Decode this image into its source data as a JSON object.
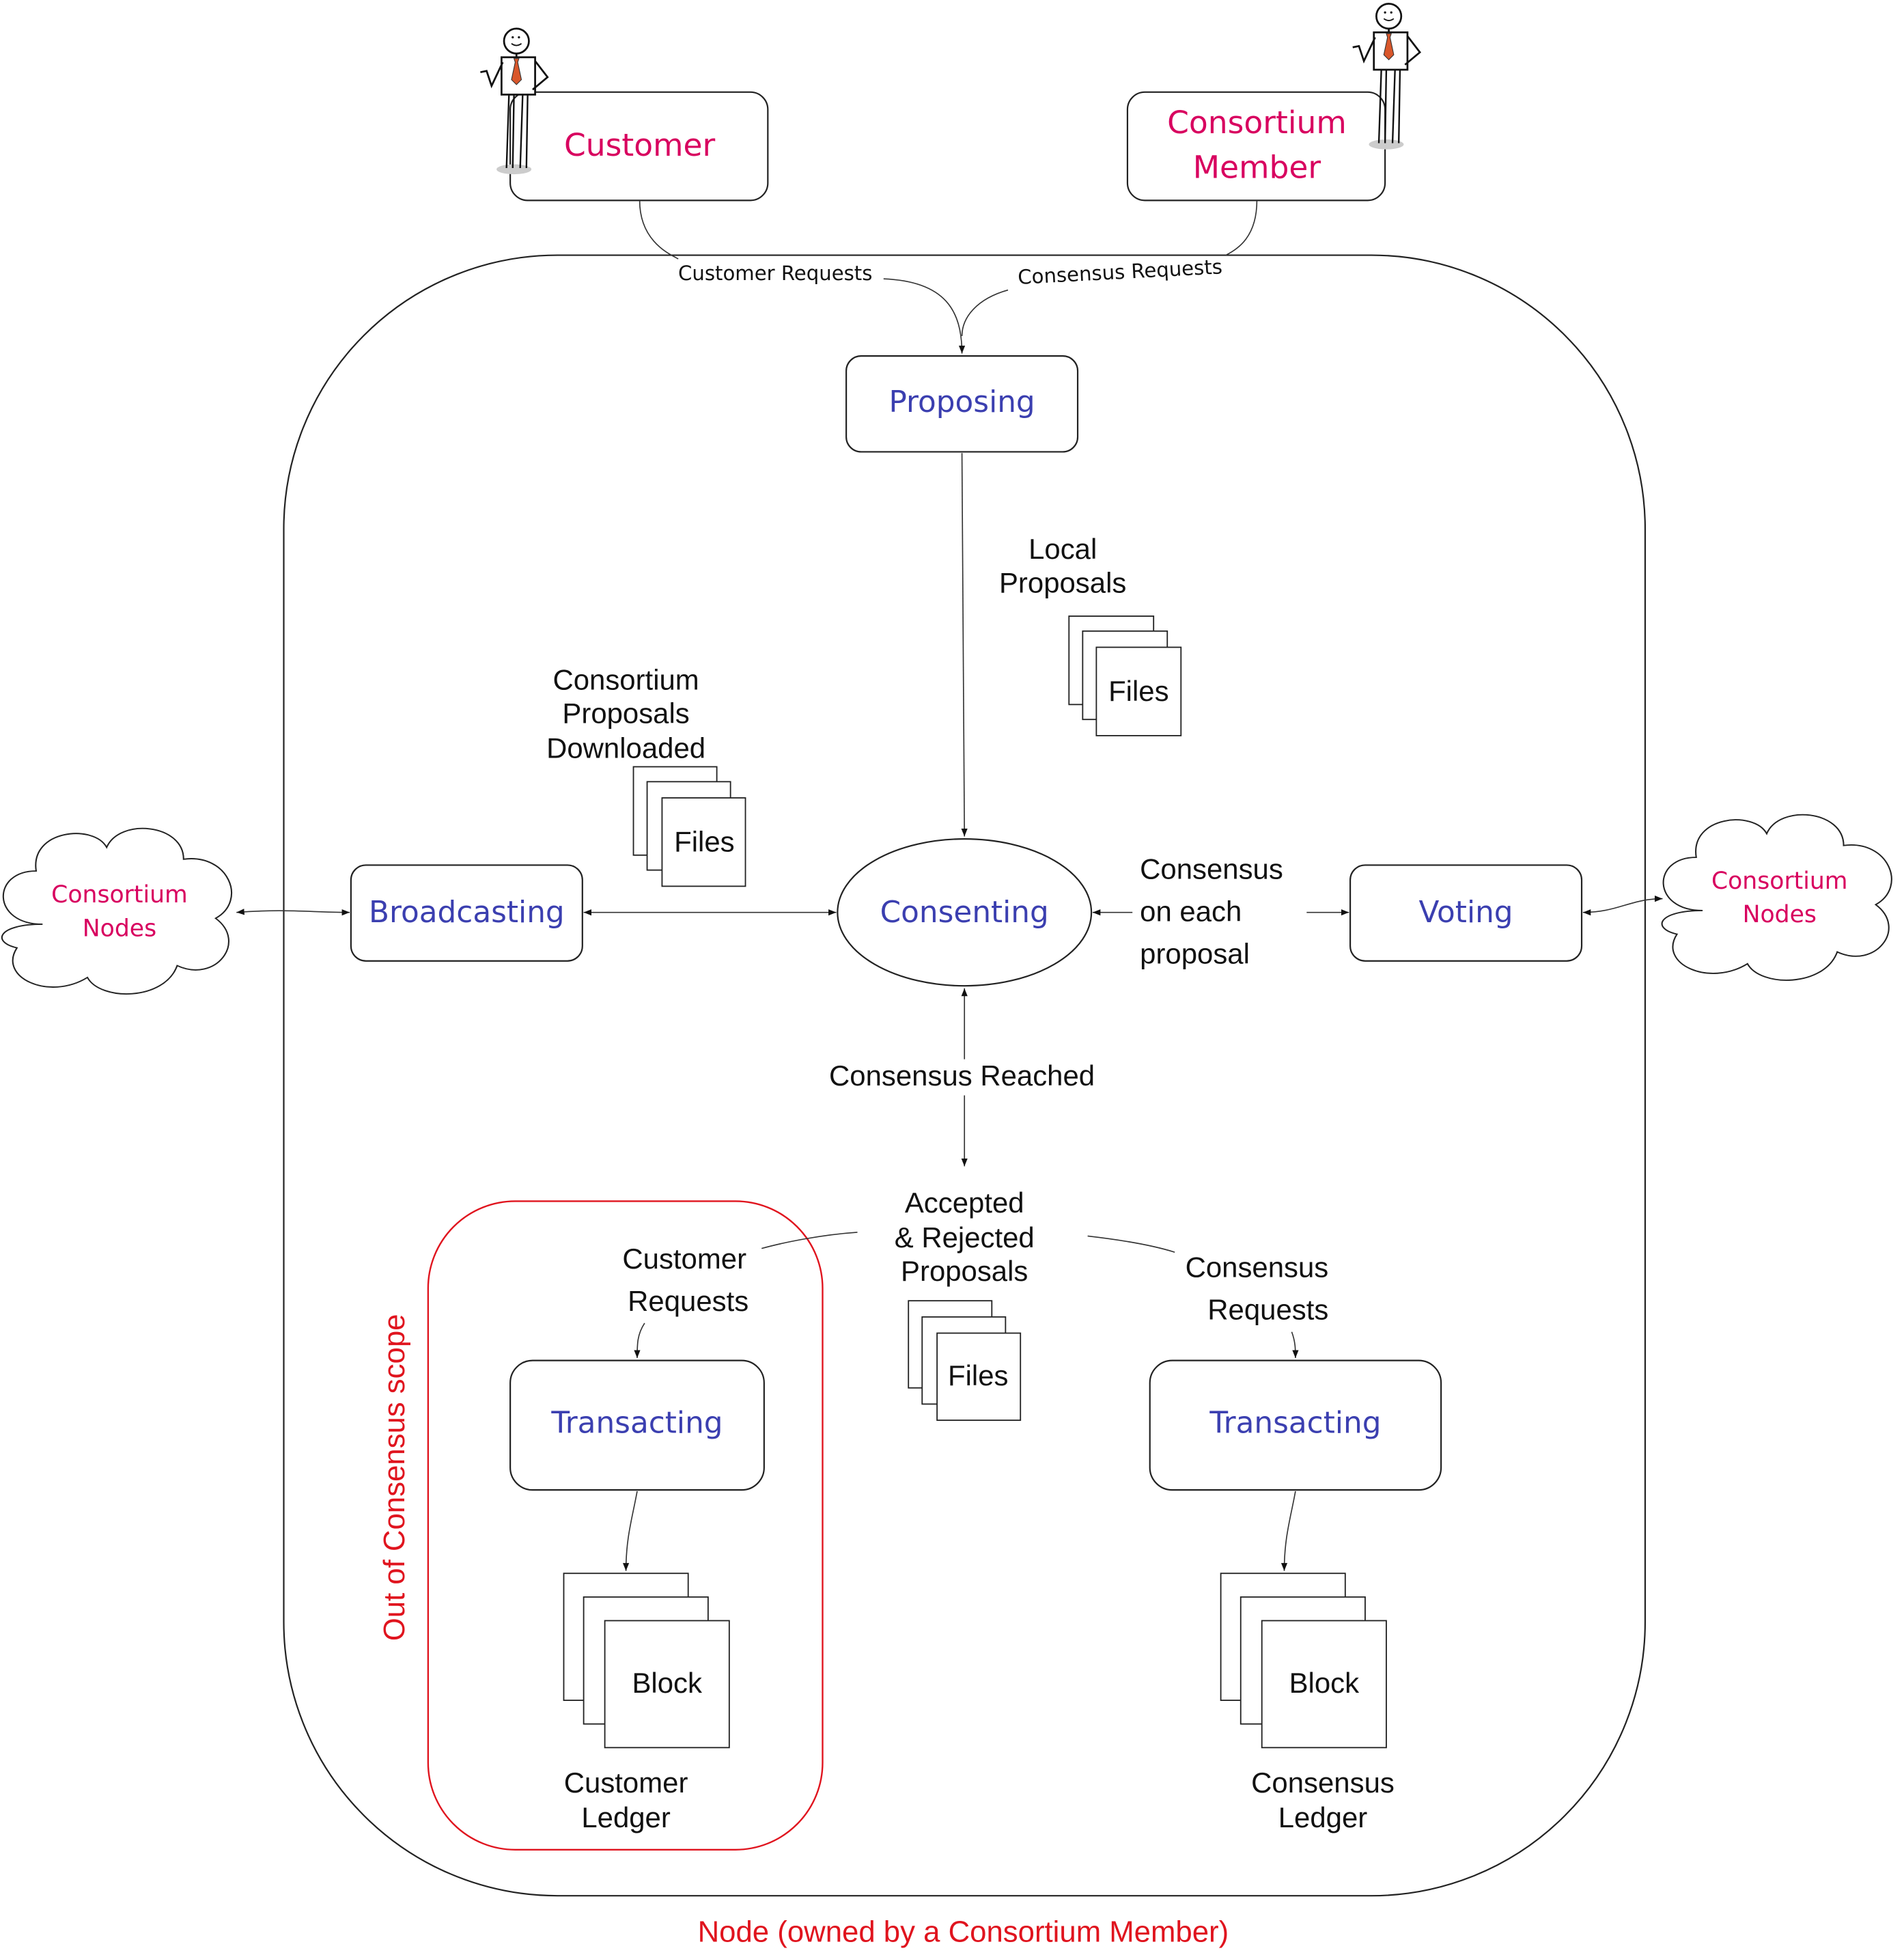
{
  "actors": {
    "customer": {
      "label": "Customer",
      "icon": "stick-figure-icon"
    },
    "consortium_member": {
      "lines": [
        "Consortium",
        "Member"
      ],
      "icon": "stick-figure-icon"
    }
  },
  "edges": {
    "customer_requests": "Customer Requests",
    "consensus_requests": "Consensus Requests",
    "local_proposals": [
      "Local",
      "Proposals"
    ],
    "consortium_proposals": [
      "Consortium",
      "Proposals",
      "Downloaded"
    ],
    "consensus_each": [
      "Consensus",
      "on each",
      "proposal"
    ],
    "consensus_reached": "Consensus Reached",
    "accepted_rejected": [
      "Accepted",
      "& Rejected",
      "Proposals"
    ],
    "customer_requests_lower": [
      "Customer",
      "Requests"
    ],
    "consensus_requests_lower": [
      "Consensus",
      "Requests"
    ]
  },
  "processes": {
    "proposing": "Proposing",
    "broadcasting": "Broadcasting",
    "consenting": "Consenting",
    "voting": "Voting",
    "transacting_left": "Transacting",
    "transacting_right": "Transacting"
  },
  "clouds": {
    "left": [
      "Consortium",
      "Nodes"
    ],
    "right": [
      "Consortium",
      "Nodes"
    ]
  },
  "files_label": "Files",
  "block_label": "Block",
  "ledgers": {
    "customer": [
      "Customer",
      "Ledger"
    ],
    "consensus": [
      "Consensus",
      "Ledger"
    ]
  },
  "scope_label": "Out of Consensus scope",
  "node_label": "Node (owned by a Consortium Member)",
  "colors": {
    "process_text": "#3b3fb0",
    "actor_text": "#d8005f",
    "scope": "#e0141e",
    "tie": "#d9572b"
  }
}
